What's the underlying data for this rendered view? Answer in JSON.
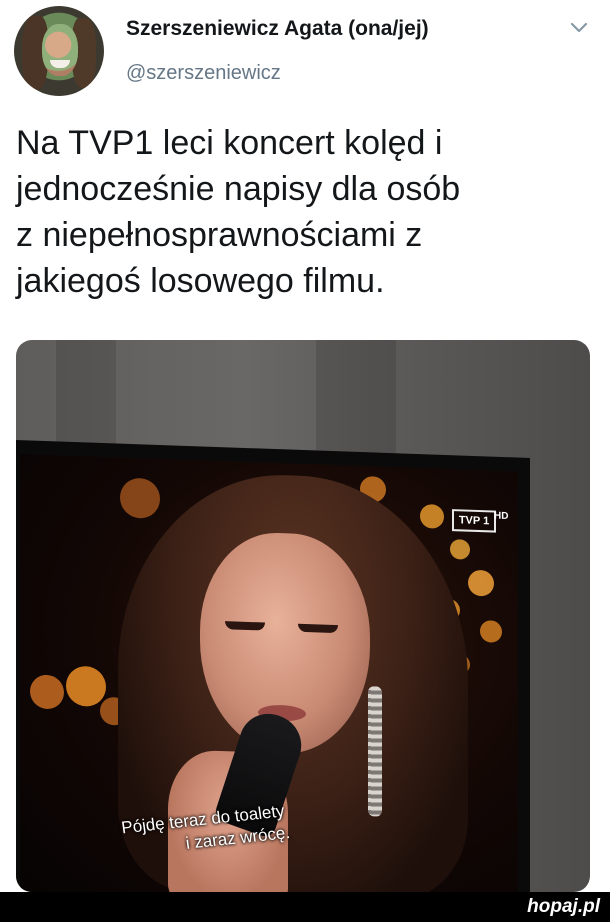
{
  "author": {
    "name": "Szerszeniewicz Agata (ona/jej)",
    "handle": "@szerszeniewicz"
  },
  "icons": {
    "menu": "chevron-down-icon"
  },
  "tweet": {
    "lines": [
      "Na TVP1 leci koncert kolęd i",
      "jednocześnie napisy dla osób",
      "z niepełnosprawnościami z",
      "jakiegoś losowego filmu."
    ]
  },
  "media": {
    "channel_logo": "TVP 1",
    "hd_label": "HD",
    "subtitle_lines": [
      "Pójdę teraz do toalety",
      "i zaraz wrócę."
    ]
  },
  "footer": {
    "watermark": "hopaj.pl"
  },
  "colors": {
    "text": "#14171a",
    "handle": "#657786",
    "footer_bg": "#000000"
  }
}
